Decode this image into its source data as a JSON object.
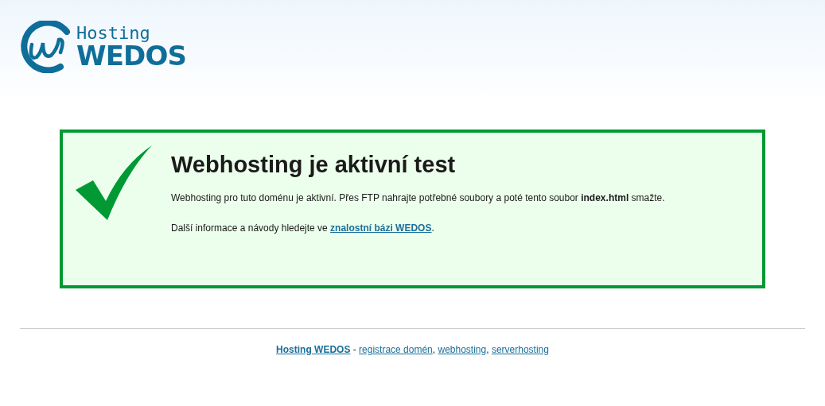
{
  "logo": {
    "top": "Hosting",
    "bottom": "WEDOS"
  },
  "notice": {
    "title": "Webhosting je aktivní test",
    "paragraph_1": "Webhosting pro tuto doménu je aktivní. Přes FTP nahrajte potřebné soubory a poté tento soubor **index.html** smažte.",
    "paragraph_2": {
      "before": "Další informace a návody hledejte ve ",
      "link": "znalostní bázi WEDOS",
      "after": "."
    }
  },
  "footer": {
    "main_link": "Hosting WEDOS",
    "separator": " - ",
    "links": [
      {
        "text": "registrace domén",
        "after": ","
      },
      {
        "text": "webhosting",
        "after": ","
      },
      {
        "text": "serverhosting"
      }
    ]
  }
}
